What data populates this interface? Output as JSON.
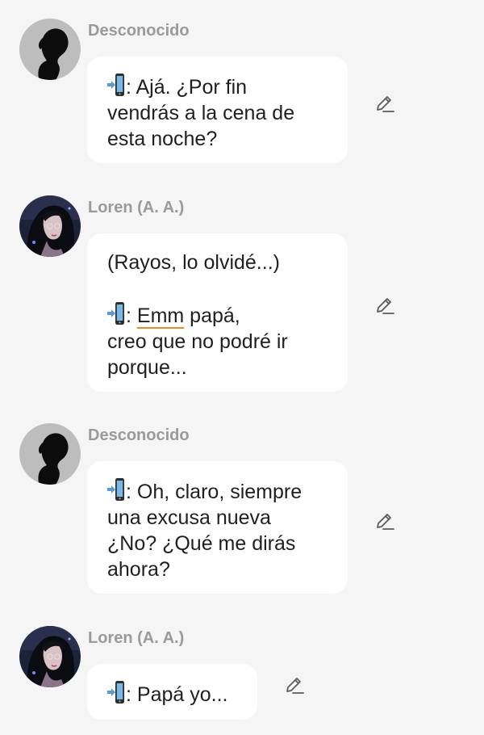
{
  "messages": [
    {
      "sender": "Desconocido",
      "lines": [
        {
          "phone": true,
          "text": ": Ajá. ¿Por fin"
        },
        {
          "text": "vendrás a la cena de"
        },
        {
          "text": "esta noche?"
        }
      ],
      "action_icon": "pencil-icon"
    },
    {
      "sender": "Loren (A. A.)",
      "lines": [
        {
          "text": "(Rayos, lo olvidé...)"
        },
        {
          "text": ""
        },
        {
          "phone": true,
          "text": ": ",
          "underlined": "Emm",
          "rest": " papá,"
        },
        {
          "text": "creo que no podré ir"
        },
        {
          "text": "porque..."
        }
      ],
      "action_icon": "pencil-icon"
    },
    {
      "sender": "Desconocido",
      "lines": [
        {
          "phone": true,
          "text": ": Oh, claro, siempre"
        },
        {
          "text": "una excusa nueva"
        },
        {
          "text": "¿No? ¿Qué me dirás"
        },
        {
          "text": "ahora?"
        }
      ],
      "action_icon": "pencil-icon"
    },
    {
      "sender": "Loren (A. A.)",
      "lines": [
        {
          "phone": true,
          "text": ": Papá yo..."
        }
      ],
      "action_icon": "pencil-icon"
    }
  ],
  "icons": {
    "phone": "mobile-phone-arrow-icon",
    "edit": "pencil-icon"
  },
  "colors": {
    "background": "#f5f5f5",
    "bubble": "#ffffff",
    "text": "#1f1f1f",
    "sender": "#9a9a9a",
    "spellcheck": "#f08a24"
  }
}
